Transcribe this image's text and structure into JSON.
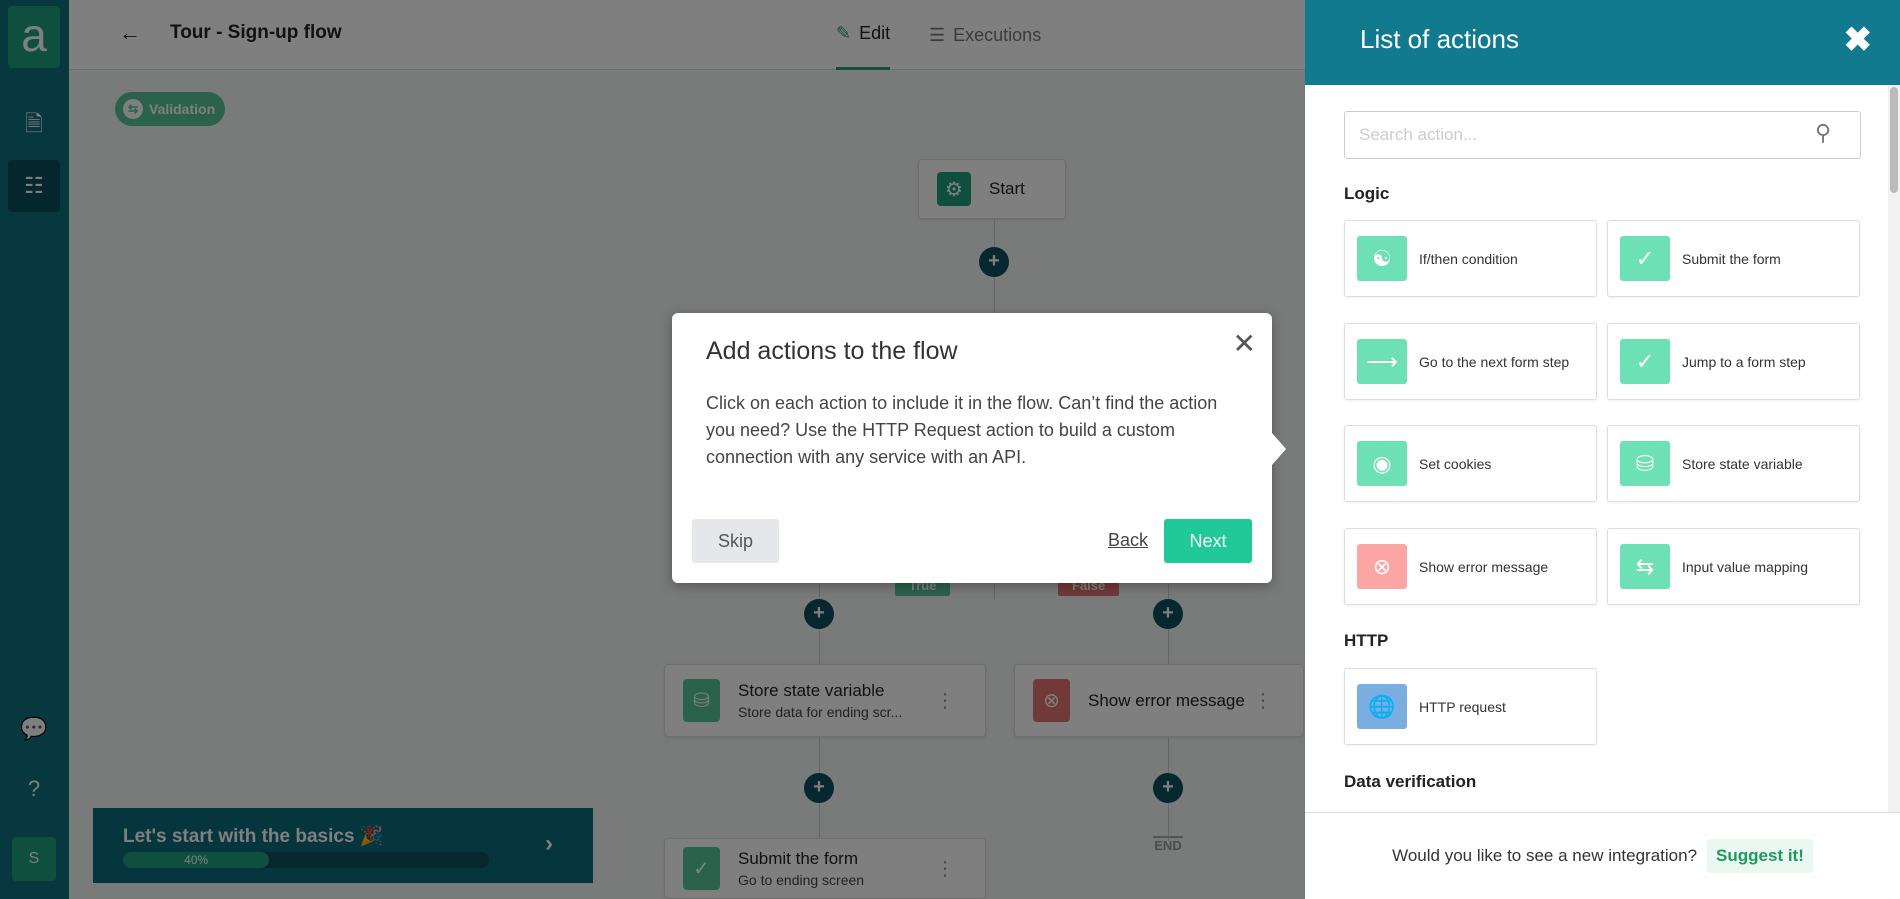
{
  "sidebar": {
    "logo": "a",
    "avatar": "S",
    "icons": [
      "document-icon",
      "sitemap-icon",
      "chat-icon",
      "help-icon"
    ]
  },
  "header": {
    "title": "Tour - Sign-up flow",
    "tabs": [
      {
        "label": "Edit",
        "active": true
      },
      {
        "label": "Executions",
        "active": false
      }
    ]
  },
  "canvas": {
    "validation_pill": "Validation",
    "start": "Start",
    "true_label": "True",
    "false_label": "False",
    "end_label": "END",
    "nodes": [
      {
        "title": "Store state variable",
        "subtitle": "Store data for ending scr..."
      },
      {
        "title": "Show error message"
      },
      {
        "title": "Submit the form",
        "subtitle": "Go to ending screen"
      }
    ]
  },
  "banner": {
    "title": "Let's start with the basics",
    "emoji": "🎉",
    "progress": 40,
    "progress_label": "40%"
  },
  "dialog": {
    "title": "Add actions to the flow",
    "body": "Click on each action to include it in the flow. Can’t find the action you need? Use the HTTP Request action to build a custom connection with any service with an API.",
    "skip": "Skip",
    "back": "Back",
    "next": "Next"
  },
  "panel": {
    "title": "List of actions",
    "search_placeholder": "Search action...",
    "sections": [
      {
        "title": "Logic",
        "items": [
          {
            "label": "If/then condition",
            "icon": "branch-icon",
            "color": "#6ee0b5"
          },
          {
            "label": "Submit the form",
            "icon": "check-circle-icon",
            "color": "#6ee0b5"
          },
          {
            "label": "Go to the next form step",
            "icon": "arrow-right-icon",
            "color": "#6ee0b5"
          },
          {
            "label": "Jump to a form step",
            "icon": "jump-arrow-icon",
            "color": "#6ee0b5"
          },
          {
            "label": "Set cookies",
            "icon": "cookie-icon",
            "color": "#6ee0b5"
          },
          {
            "label": "Store state variable",
            "icon": "database-edit-icon",
            "color": "#6ee0b5"
          },
          {
            "label": "Show error message",
            "icon": "x-circle-icon",
            "color": "#fca5a5"
          },
          {
            "label": "Input value mapping",
            "icon": "swap-icon",
            "color": "#6ee0b5"
          }
        ]
      },
      {
        "title": "HTTP",
        "items": [
          {
            "label": "HTTP request",
            "icon": "globe-icon",
            "color": "#7aaee0"
          }
        ]
      },
      {
        "title": "Data verification"
      }
    ],
    "footer_text": "Would you like to see a new integration?",
    "suggest": "Suggest it!"
  },
  "colors": {
    "accent": "#1f9f7d",
    "panel_header": "#127a8e",
    "next": "#20c997"
  }
}
